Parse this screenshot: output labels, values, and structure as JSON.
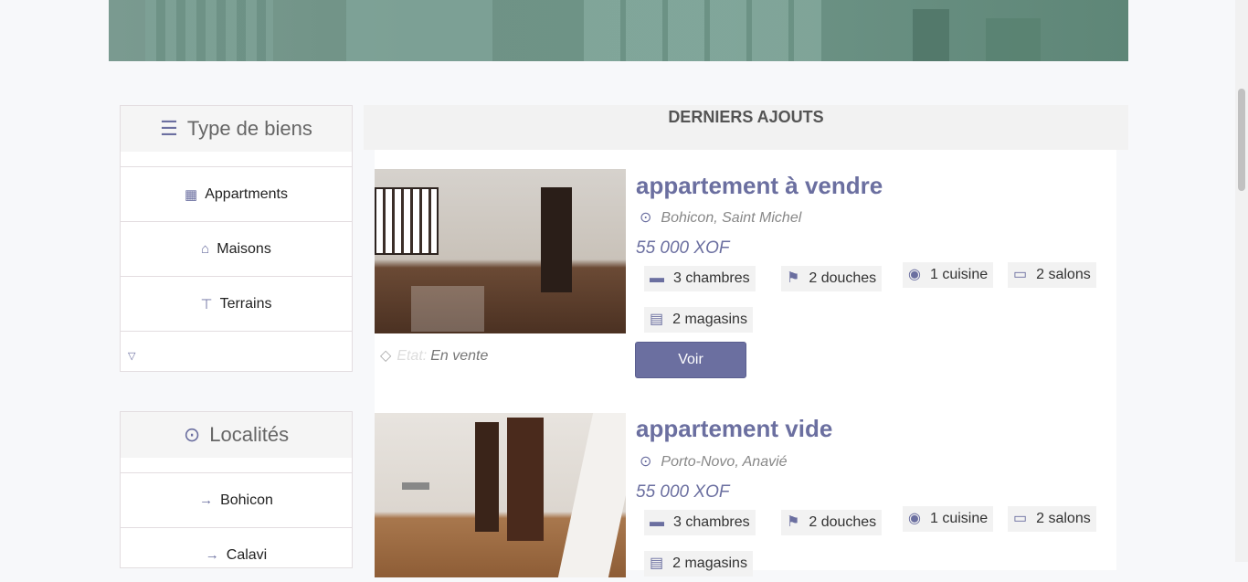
{
  "sidebar": {
    "types": {
      "title": "Type de biens",
      "icon": "list-icon",
      "items": [
        {
          "label": "Appartments",
          "icon": "building-icon"
        },
        {
          "label": "Maisons",
          "icon": "house-icon"
        },
        {
          "label": "Terrains",
          "icon": "signpost-icon"
        }
      ],
      "more_icon": "chevron-down-icon"
    },
    "locations": {
      "title": "Localités",
      "icon": "map-pin-icon",
      "items": [
        {
          "label": "Bohicon",
          "icon": "arrow-right-icon"
        },
        {
          "label": "Calavi",
          "icon": "arrow-right-icon"
        }
      ]
    }
  },
  "main": {
    "heading": "DERNIERS AJOUTS",
    "listings": [
      {
        "title": "appartement à vendre",
        "location": "Bohicon, Saint Michel",
        "price": "55 000 XOF",
        "features": [
          "3 chambres",
          "2 douches",
          "1 cuisine",
          "2 salons",
          "2 magasins"
        ],
        "status_label": "Etat:",
        "status": "En vente",
        "button": "Voir"
      },
      {
        "title": "appartement vide",
        "location": "Porto-Novo, Anavié",
        "price": "55 000 XOF",
        "features": [
          "3 chambres",
          "2 douches",
          "1 cuisine",
          "2 salons",
          "2 magasins"
        ]
      }
    ]
  },
  "colors": {
    "accent": "#6b6fa0",
    "panel_bg": "#f5f5f5",
    "page_bg": "#f7f8fa"
  }
}
